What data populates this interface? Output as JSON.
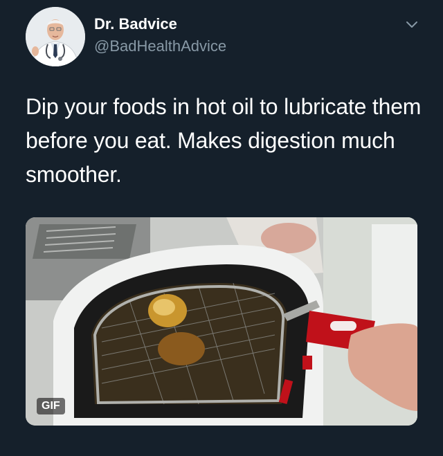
{
  "author": {
    "display_name": "Dr. Badvice",
    "handle": "@BadHealthAdvice"
  },
  "tweet": {
    "text": "Dip your foods in hot oil to lubricate them before you eat. Makes digestion much smoother."
  },
  "media": {
    "badge": "GIF"
  },
  "icons": {
    "menu": "chevron-down-icon",
    "avatar": "doctor-portrait"
  },
  "colors": {
    "background": "#15202b",
    "secondary_text": "#8899a6",
    "primary_text": "#ffffff"
  }
}
